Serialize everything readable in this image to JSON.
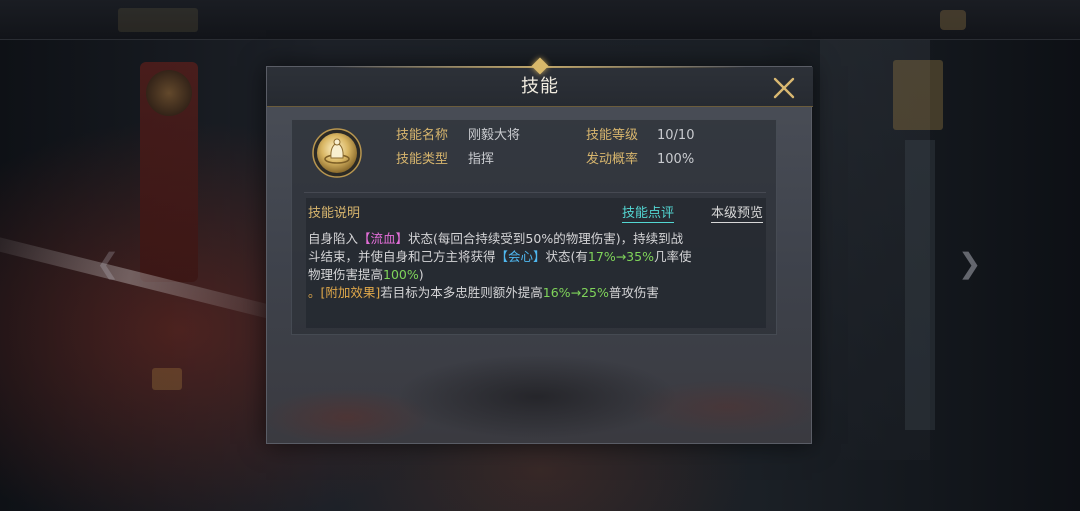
{
  "dialog": {
    "title": "技能",
    "info": {
      "name_label": "技能名称",
      "name_value": "刚毅大将",
      "level_label": "技能等级",
      "level_value": "10/10",
      "type_label": "技能类型",
      "type_value": "指挥",
      "chance_label": "发动概率",
      "chance_value": "100%"
    },
    "description": {
      "title": "技能说明",
      "review_link": "技能点评",
      "preview_link": "本级预览",
      "line1": {
        "a": "自身陷入",
        "bleed": "【流血】",
        "b": "状态(每回合持续受到50%的物理伤害)，持续到战"
      },
      "line2": {
        "a": "斗结束，并使自身和己方主将获得",
        "crit": "【会心】",
        "b": "状态(有",
        "pct": "17%→35%",
        "c": "几率使"
      },
      "line3": {
        "a": "物理伤害提高",
        "pct": "100%",
        "b": ")"
      },
      "line4": {
        "tag": "。[附加效果]",
        "a": "若目标为本多忠胜则额外提高",
        "pct": "16%→25%",
        "b": "普攻伤害"
      }
    }
  },
  "colors": {
    "label_gold": "#d7b56d",
    "keyword_pink": "#e36ed8",
    "keyword_blue": "#4fb8f0",
    "value_green": "#7fd45a",
    "link_cyan": "#53d7d3"
  }
}
